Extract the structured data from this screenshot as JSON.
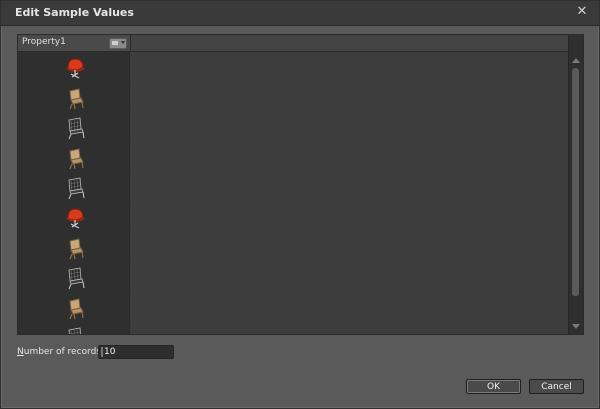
{
  "window": {
    "title": "Edit Sample Values"
  },
  "grid": {
    "column_header": "Property1",
    "rows": [
      {
        "icon": "chair-red-icon"
      },
      {
        "icon": "chair-wood-icon"
      },
      {
        "icon": "chair-mesh-icon"
      },
      {
        "icon": "chair-wood-icon"
      },
      {
        "icon": "chair-mesh-icon"
      },
      {
        "icon": "chair-red-icon"
      },
      {
        "icon": "chair-wood-icon"
      },
      {
        "icon": "chair-mesh-icon"
      },
      {
        "icon": "chair-wood-icon"
      },
      {
        "icon": "chair-mesh-icon"
      }
    ]
  },
  "records": {
    "label_prefix": "N",
    "label_rest": "umber of records",
    "value": "10"
  },
  "buttons": {
    "ok": "OK",
    "cancel": "Cancel"
  },
  "colors": {
    "title_bg": "#3a3a3a",
    "panel_bg": "#5a5a5a",
    "grid_bg": "#3b3b3b",
    "chair_red": "#d73b1b",
    "chair_wood": "#c9a77a",
    "chair_mesh": "#2b2b2b"
  }
}
